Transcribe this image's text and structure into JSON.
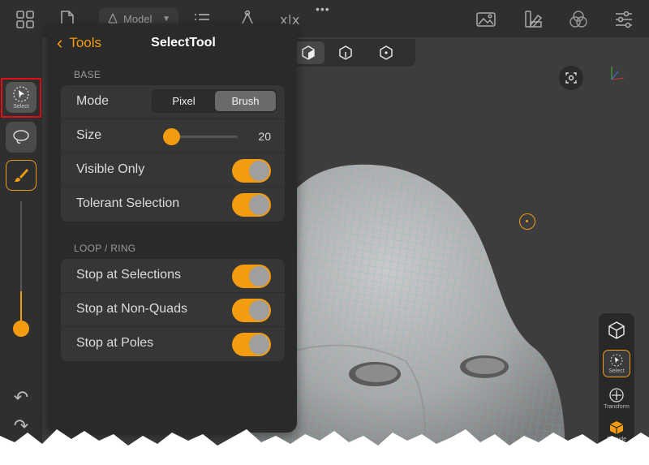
{
  "topbar": {
    "mode_label": "Model",
    "icons": [
      "grid-icon",
      "document-icon",
      "model-icon",
      "list-icon",
      "vertex-icon",
      "formula-icon",
      "image-icon",
      "swatch-icon",
      "material-icon",
      "sliders-icon"
    ]
  },
  "left_toolbar": {
    "select_caption": "Select",
    "brush_size_level": 0.33
  },
  "panel": {
    "back_label": "Tools",
    "title": "SelectTool",
    "base_section": "BASE",
    "mode_label": "Mode",
    "mode_options": [
      "Pixel",
      "Brush"
    ],
    "mode_selected": "Brush",
    "size_label": "Size",
    "size_value": "20",
    "visible_only_label": "Visible Only",
    "tolerant_label": "Tolerant Selection",
    "loop_section": "LOOP / RING",
    "stop_selections_label": "Stop at Selections",
    "stop_nonquads_label": "Stop at Non-Quads",
    "stop_poles_label": "Stop at Poles"
  },
  "right_rail": {
    "select_caption": "Select",
    "transform_caption": "Transform",
    "extrude_caption": "Extrude"
  },
  "colors": {
    "accent": "#f39c12",
    "panel": "#2a2a2a",
    "row": "#363636",
    "highlight": "#e0101a"
  }
}
